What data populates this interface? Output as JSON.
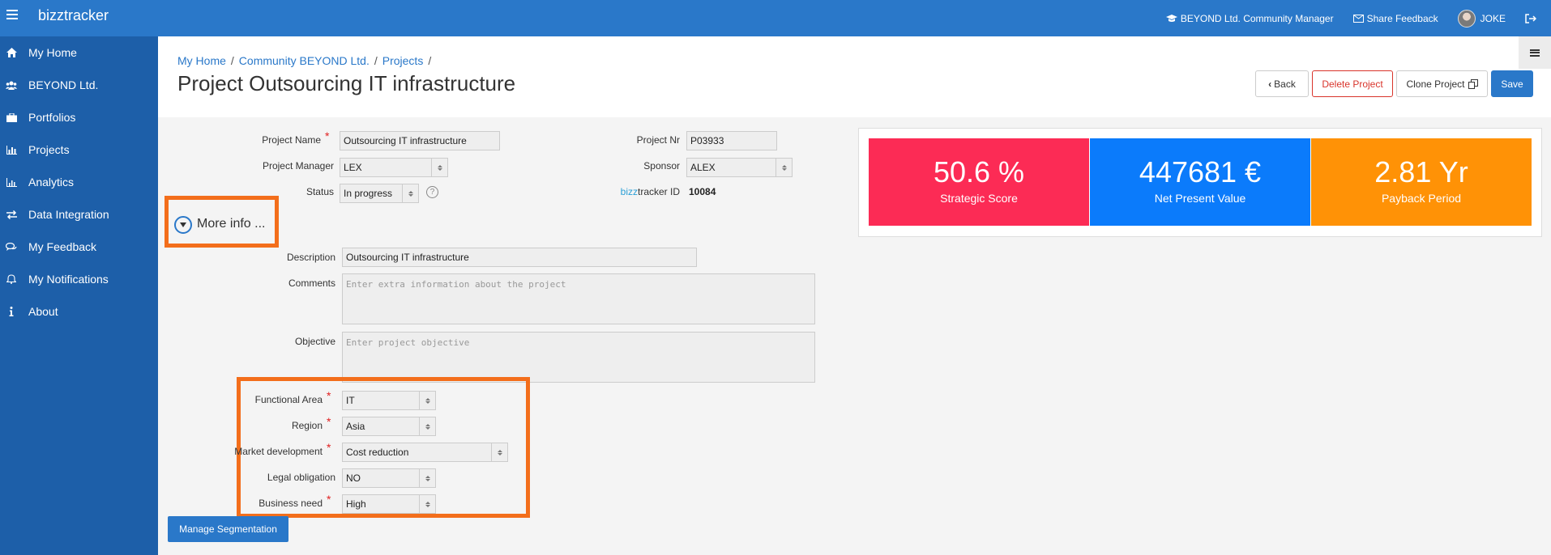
{
  "app": {
    "brand": "bizztracker"
  },
  "topbar": {
    "community": "BEYOND Ltd. Community Manager",
    "feedback": "Share Feedback",
    "user": "JOKE"
  },
  "sidebar": {
    "items": [
      {
        "label": "My Home",
        "icon": "home-icon"
      },
      {
        "label": "BEYOND Ltd.",
        "icon": "users-icon"
      },
      {
        "label": "Portfolios",
        "icon": "briefcase-icon"
      },
      {
        "label": "Projects",
        "icon": "bar-chart-icon"
      },
      {
        "label": "Analytics",
        "icon": "line-chart-icon"
      },
      {
        "label": "Data Integration",
        "icon": "exchange-icon"
      },
      {
        "label": "My Feedback",
        "icon": "comments-icon"
      },
      {
        "label": "My Notifications",
        "icon": "bell-icon"
      },
      {
        "label": "About",
        "icon": "info-icon"
      }
    ]
  },
  "breadcrumb": {
    "home": "My Home",
    "community": "Community BEYOND Ltd.",
    "projects": "Projects",
    "sep": "/"
  },
  "page": {
    "title": "Project Outsourcing IT infrastructure"
  },
  "toolbar": {
    "back": "Back",
    "delete": "Delete Project",
    "clone": "Clone Project",
    "save": "Save"
  },
  "form": {
    "project_name_label": "Project Name",
    "project_name_value": "Outsourcing IT infrastructure",
    "project_nr_label": "Project Nr",
    "project_nr_value": "P03933",
    "manager_label": "Project Manager",
    "manager_value": "LEX",
    "sponsor_label": "Sponsor",
    "sponsor_value": "ALEX",
    "status_label": "Status",
    "status_value": "In progress",
    "help": "?",
    "id_label_prefix": "bizz",
    "id_label_suffix": "tracker ID",
    "id_value": "10084",
    "more_info": "More info ...",
    "description_label": "Description",
    "description_value": "Outsourcing IT infrastructure",
    "comments_label": "Comments",
    "comments_placeholder": "Enter extra information about the project",
    "objective_label": "Objective",
    "objective_placeholder": "Enter project objective",
    "functional_area_label": "Functional Area",
    "functional_area_value": "IT",
    "region_label": "Region",
    "region_value": "Asia",
    "market_label": "Market development",
    "market_value": "Cost reduction",
    "legal_label": "Legal obligation",
    "legal_value": "NO",
    "business_need_label": "Business need",
    "business_need_value": "High",
    "required_mark": "*",
    "manage_segmentation": "Manage Segmentation"
  },
  "kpis": [
    {
      "value": "50.6 %",
      "caption": "Strategic Score",
      "color": "#fc2b55"
    },
    {
      "value": "447681 €",
      "caption": "Net Present Value",
      "color": "#0b7bfb"
    },
    {
      "value": "2.81 Yr",
      "caption": "Payback Period",
      "color": "#ff9206"
    }
  ],
  "colors": {
    "topbar": "#2a78c9",
    "sidebar": "#1d5fa9",
    "highlight": "#f36e1b"
  }
}
